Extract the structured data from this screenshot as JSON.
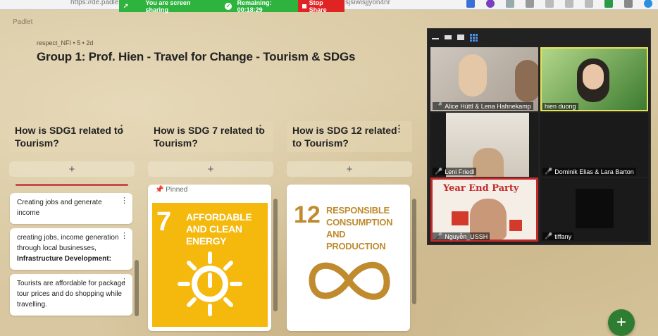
{
  "browser": {
    "url_left": "https://de.padle",
    "url_right": "sjsiwisjjyon4nr"
  },
  "share_banner": {
    "message": "You are screen sharing",
    "remaining": "Remaining: 00:18:29",
    "stop_label": "Stop Share"
  },
  "padlet": {
    "logo": "Padlet",
    "meta": "respect_NFI • 5 • 2d",
    "title": "Group 1: Prof. Hien - Travel for Change - Tourism & SDGs"
  },
  "columns": [
    {
      "heading": "How is SDG1  related to Tourism?",
      "add_label": "+",
      "posts": [
        {
          "text": "Creating jobs and generate income"
        },
        {
          "text": "creating jobs, income generation through local businesses,",
          "bold": "Infrastructure Development",
          "bold_suffix": ":"
        },
        {
          "text": "Tourists are affordable for package tour prices and do shopping while travelling."
        }
      ]
    },
    {
      "heading": "How is SDG 7 related to Tourism?",
      "add_label": "+",
      "pinned_label": "Pinned",
      "sdg": {
        "number": "7",
        "text": "AFFORDABLE AND CLEAN ENERGY",
        "color": "#f5b80c"
      }
    },
    {
      "heading": "How is SDG 12 related to Tourism?",
      "add_label": "+",
      "sdg": {
        "number": "12",
        "text": "RESPONSIBLE CONSUMPTION AND PRODUCTION",
        "color": "#bf8b2e"
      }
    }
  ],
  "video": {
    "tiles": [
      {
        "name": "Alice Hüttl & Lena Hahnekamp",
        "muted": true
      },
      {
        "name": "hien duong",
        "muted": false,
        "active": true
      },
      {
        "name": "Leni Friedl",
        "muted": true
      },
      {
        "name": "Dominik Elias & Lara Barton",
        "muted": true
      },
      {
        "name": "Nguyễn_USSH",
        "muted": true,
        "banner": "Year End Party"
      },
      {
        "name": "tiffany",
        "muted": true
      }
    ]
  },
  "fab_label": "+",
  "icons": {
    "dots": "more-icon",
    "pin": "pin-icon",
    "mic": "mic-muted-icon",
    "add": "plus-icon"
  }
}
